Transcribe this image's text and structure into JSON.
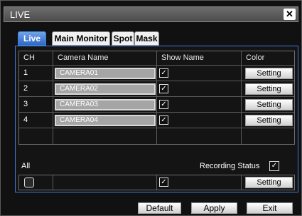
{
  "window": {
    "title": "LIVE",
    "close_glyph": "✕"
  },
  "tabs": [
    {
      "label": "Live",
      "active": true
    },
    {
      "label": "Main Monitor",
      "active": false
    },
    {
      "label": "Spot",
      "active": false
    },
    {
      "label": "Mask",
      "active": false
    }
  ],
  "table": {
    "headers": {
      "ch": "CH",
      "name": "Camera Name",
      "show": "Show Name",
      "color": "Color"
    },
    "rows": [
      {
        "ch": "1",
        "name": "CAMERA01",
        "show_name": true,
        "color_button": "Setting"
      },
      {
        "ch": "2",
        "name": "CAMERA02",
        "show_name": true,
        "color_button": "Setting"
      },
      {
        "ch": "3",
        "name": "CAMERA03",
        "show_name": true,
        "color_button": "Setting"
      },
      {
        "ch": "4",
        "name": "CAMERA04",
        "show_name": true,
        "color_button": "Setting"
      }
    ]
  },
  "all_section": {
    "all_label": "All",
    "recording_status_label": "Recording Status",
    "recording_status_checked": true,
    "all_checked": false,
    "all_show_name": true,
    "all_color_button": "Setting"
  },
  "footer": {
    "default_label": "Default",
    "apply_label": "Apply",
    "exit_label": "Exit"
  },
  "icons": {
    "check": "✓"
  },
  "colors": {
    "accent_blue": "#3e78d8",
    "active_tab": "#2f67c4"
  }
}
